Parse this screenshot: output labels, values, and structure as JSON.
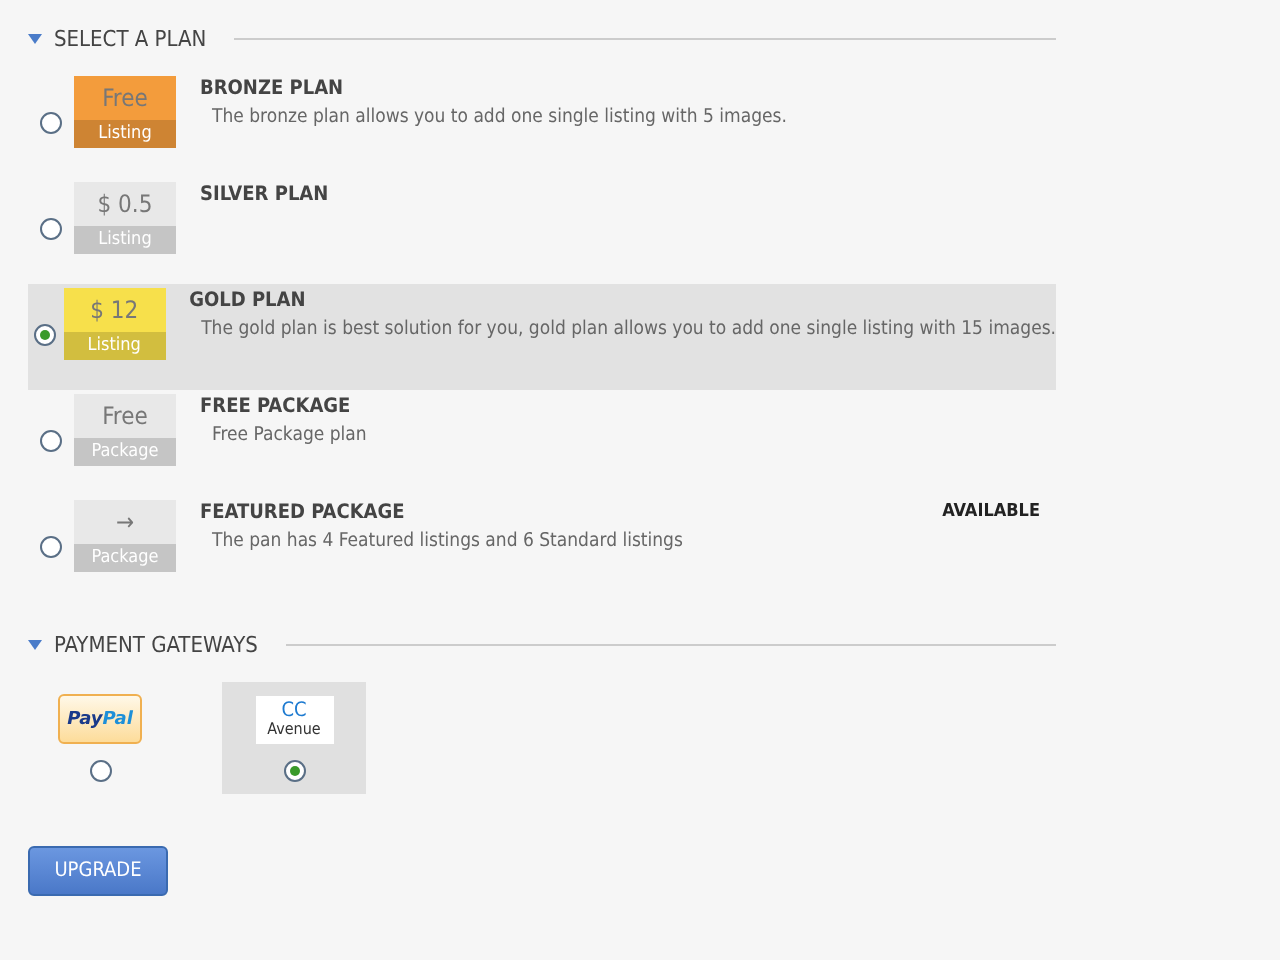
{
  "plan_section": {
    "title": "SELECT A PLAN",
    "expanded": true
  },
  "plans": [
    {
      "price": "Free",
      "unit": "Listing",
      "color": "#f39c3c",
      "title": "BRONZE PLAN",
      "description": "The bronze plan allows you to add one single listing with 5 images.",
      "selected": false
    },
    {
      "price": "$ 0.5",
      "unit": "Listing",
      "color": "#e8e8e8",
      "title": "SILVER PLAN",
      "selected": false
    },
    {
      "price": "$ 12",
      "unit": "Listing",
      "color": "#f7e04b",
      "title": "GOLD PLAN",
      "description": "The gold plan is best solution for you, gold plan allows you to add one single listing with 15 images.",
      "selected": true
    },
    {
      "price": "Free",
      "unit": "Package",
      "color": "#e8e8e8",
      "title": "FREE PACKAGE",
      "description": "Free Package plan",
      "selected": false
    },
    {
      "price": "→",
      "unit": "Package",
      "color": "#e8e8e8",
      "title": "FEATURED PACKAGE",
      "description": "The pan has 4 Featured listings and 6 Standard listings",
      "badge": "AVAILABLE",
      "selected": false
    }
  ],
  "payment_section": {
    "title": "PAYMENT GATEWAYS",
    "expanded": true
  },
  "gateways": [
    {
      "kind": "paypal",
      "logo": [
        "Pay",
        "Pal"
      ],
      "selected": false
    },
    {
      "kind": "ccavenue",
      "logo": [
        "CC",
        "Avenue"
      ],
      "selected": true
    }
  ],
  "submit": "UPGRADE"
}
